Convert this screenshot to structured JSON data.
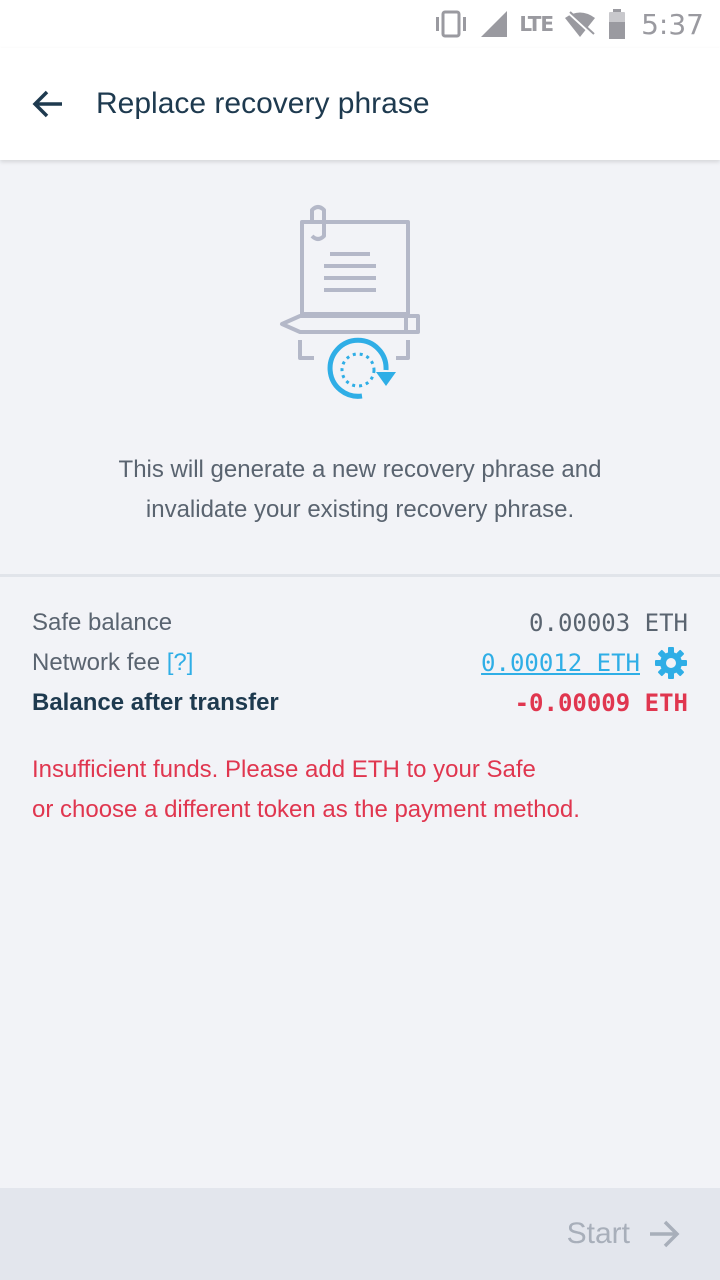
{
  "status_bar": {
    "time": "5:37",
    "network": "LTE",
    "icons": [
      "vibrate-icon",
      "signal-icon",
      "wifi-off-icon",
      "battery-icon"
    ]
  },
  "toolbar": {
    "title": "Replace recovery phrase",
    "back_icon": "arrow-left-icon"
  },
  "hero": {
    "illustration": "document-pen-refresh-icon",
    "description_line1": "This will generate a new recovery phrase and",
    "description_line2": "invalidate your existing recovery phrase."
  },
  "fees": {
    "safe_balance_label": "Safe balance",
    "safe_balance_value": "0.00003 ETH",
    "network_fee_label": "Network fee",
    "network_fee_help": "[?]",
    "network_fee_value": "0.00012 ETH",
    "balance_after_label": "Balance after transfer",
    "balance_after_value": "-0.00009 ETH"
  },
  "error": {
    "line1": "Insufficient funds. Please add ETH to your Safe",
    "line2": "or choose a different token as the payment method."
  },
  "footer": {
    "start_label": "Start"
  },
  "colors": {
    "accent": "#2faee6",
    "error": "#e0364f",
    "title": "#1e3a4f",
    "background": "#f2f3f7"
  }
}
